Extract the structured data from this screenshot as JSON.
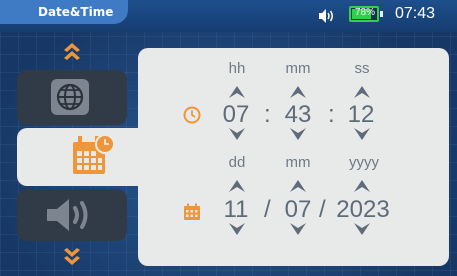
{
  "header": {
    "title": "Date&Time",
    "battery": "78%",
    "battery_level": 0.78,
    "time": "07:43",
    "speaker_icon": "speaker-volume-icon"
  },
  "sidebar": {
    "items": [
      {
        "name": "globe",
        "icon": "globe-icon"
      },
      {
        "name": "calendar",
        "icon": "calendar-clock-icon",
        "active": true
      },
      {
        "name": "sound",
        "icon": "speaker-icon"
      }
    ]
  },
  "time": {
    "hour_label": "hh",
    "minute_label": "mm",
    "second_label": "ss",
    "hour": "07",
    "minute": "43",
    "second": "12",
    "separator": ":"
  },
  "date": {
    "day_label": "dd",
    "month_label": "mm",
    "year_label": "yyyy",
    "day": "11",
    "month": "07",
    "year": "2023",
    "separator": "/"
  },
  "colors": {
    "accent": "#f0963a",
    "panel": "#e8eaea",
    "background": "#1d4678",
    "battery": "#2fd14a"
  }
}
